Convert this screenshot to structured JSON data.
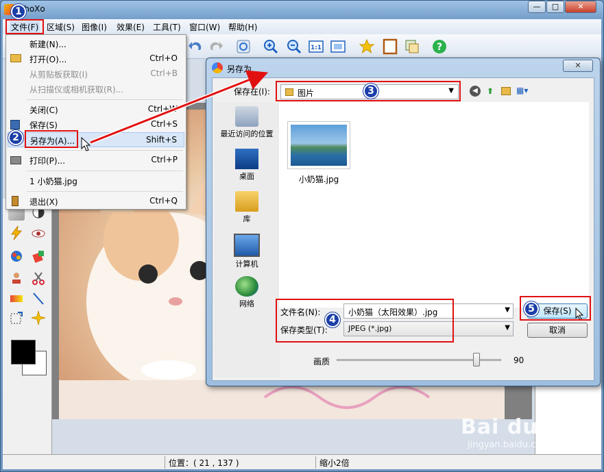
{
  "window": {
    "title": "PhoXo",
    "controls": [
      "—",
      "□",
      "✕"
    ]
  },
  "menubar": {
    "items": [
      "文件(F)",
      "区域(S)",
      "图像(I)",
      "效果(E)",
      "工具(T)",
      "窗口(W)",
      "帮助(H)"
    ]
  },
  "file_menu": {
    "items": [
      {
        "label": "新建(N)...",
        "shortcut": ""
      },
      {
        "label": "打开(O)...",
        "shortcut": "Ctrl+O"
      },
      {
        "label": "从剪贴板获取(I)",
        "shortcut": "Ctrl+B"
      },
      {
        "label": "从扫描仪或相机获取(R)...",
        "shortcut": ""
      },
      {
        "label": "关闭(C)",
        "shortcut": "Ctrl+W"
      },
      {
        "label": "保存(S)",
        "shortcut": "Ctrl+S"
      },
      {
        "label": "另存为(A)...",
        "shortcut": "Shift+S"
      },
      {
        "label": "打印(P)...",
        "shortcut": "Ctrl+P"
      },
      {
        "label": "1 小奶猫.jpg",
        "shortcut": ""
      },
      {
        "label": "退出(X)",
        "shortcut": "Ctrl+Q"
      }
    ]
  },
  "dialog": {
    "title": "另存为",
    "save_in_label": "保存在(I):",
    "save_in_value": "图片",
    "places": [
      "最近访问的位置",
      "桌面",
      "库",
      "计算机",
      "网络"
    ],
    "files": [
      {
        "name": "小奶猫.jpg"
      }
    ],
    "filename_label": "文件名(N):",
    "filename_value": "小奶猫（太阳效果）.jpg",
    "filetype_label": "保存类型(T):",
    "filetype_value": "JPEG (*.jpg)",
    "save_button": "保存(S)",
    "cancel_button": "取消",
    "quality_label": "画质",
    "quality_value": "90",
    "quality_level": 0.9
  },
  "status": {
    "position": "位置：( 21 , 137 )",
    "zoom": "缩小2倍"
  },
  "annotations": {
    "badges": [
      "1",
      "2",
      "3",
      "4",
      "5"
    ],
    "highlight_color": "#e11010",
    "badge_color": "#1b3fa8"
  },
  "watermark": {
    "logo": "Bai du 经验",
    "url": "jingyan.baidu.com"
  }
}
